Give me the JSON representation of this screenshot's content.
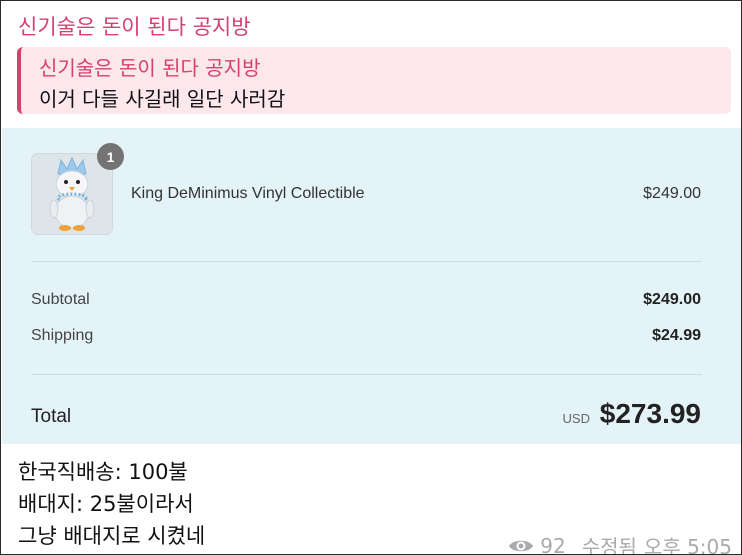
{
  "message": {
    "sender": "신기술은 돈이 된다 공지방",
    "reply": {
      "title": "신기술은 돈이 된다 공지방",
      "text": "이거 다들 사길래 일단 사러감"
    },
    "caption_lines": [
      "한국직배송: 100불",
      "배대지: 25불이라서",
      "그냥 배대지로 시켰네"
    ],
    "views": "92",
    "edited_label": "수정됨",
    "time": "오후 5:05",
    "icons": {
      "views": "eye-icon"
    }
  },
  "checkout": {
    "item": {
      "name": "King DeMinimus Vinyl Collectible",
      "price": "$249.00",
      "quantity": "1"
    },
    "subtotal_label": "Subtotal",
    "subtotal_value": "$249.00",
    "shipping_label": "Shipping",
    "shipping_value": "$24.99",
    "total_label": "Total",
    "currency": "USD",
    "total_value": "$273.99"
  },
  "colors": {
    "accent": "#d6406e",
    "reply_bg": "#fbe7ec",
    "checkout_bg": "#e4f3f7",
    "meta_text": "#a9aaad"
  }
}
